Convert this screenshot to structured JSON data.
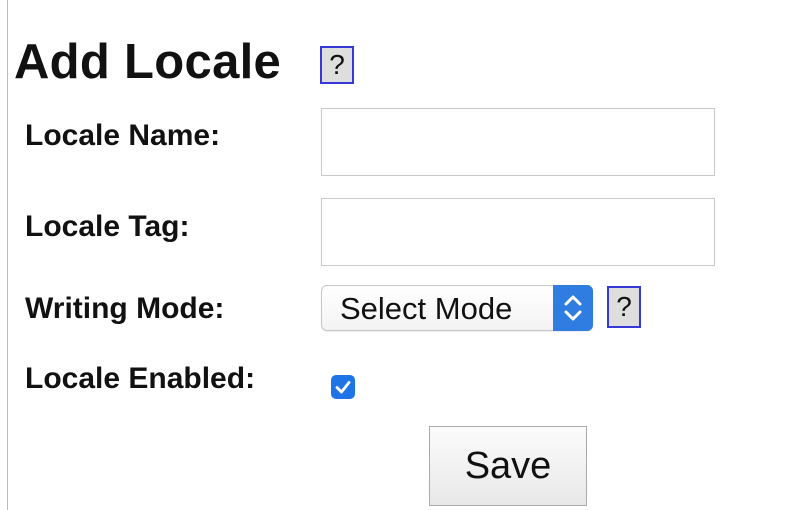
{
  "form": {
    "title": "Add Locale",
    "title_help_label": "?",
    "fields": {
      "locale_name": {
        "label": "Locale Name:",
        "value": "",
        "placeholder": ""
      },
      "locale_tag": {
        "label": "Locale Tag:",
        "value": "",
        "placeholder": ""
      },
      "writing_mode": {
        "label": "Writing Mode:",
        "selected": "Select Mode",
        "help_label": "?"
      },
      "locale_enabled": {
        "label": "Locale Enabled:",
        "checked": true
      }
    },
    "save_label": "Save"
  },
  "colors": {
    "help_border": "#3838d8",
    "help_background": "#dedede",
    "accent": "#2f7de1",
    "checkbox": "#1e74e6"
  },
  "icons": {
    "select_arrows": "updown-chevron-icon",
    "checkbox_mark": "checkmark-icon"
  }
}
